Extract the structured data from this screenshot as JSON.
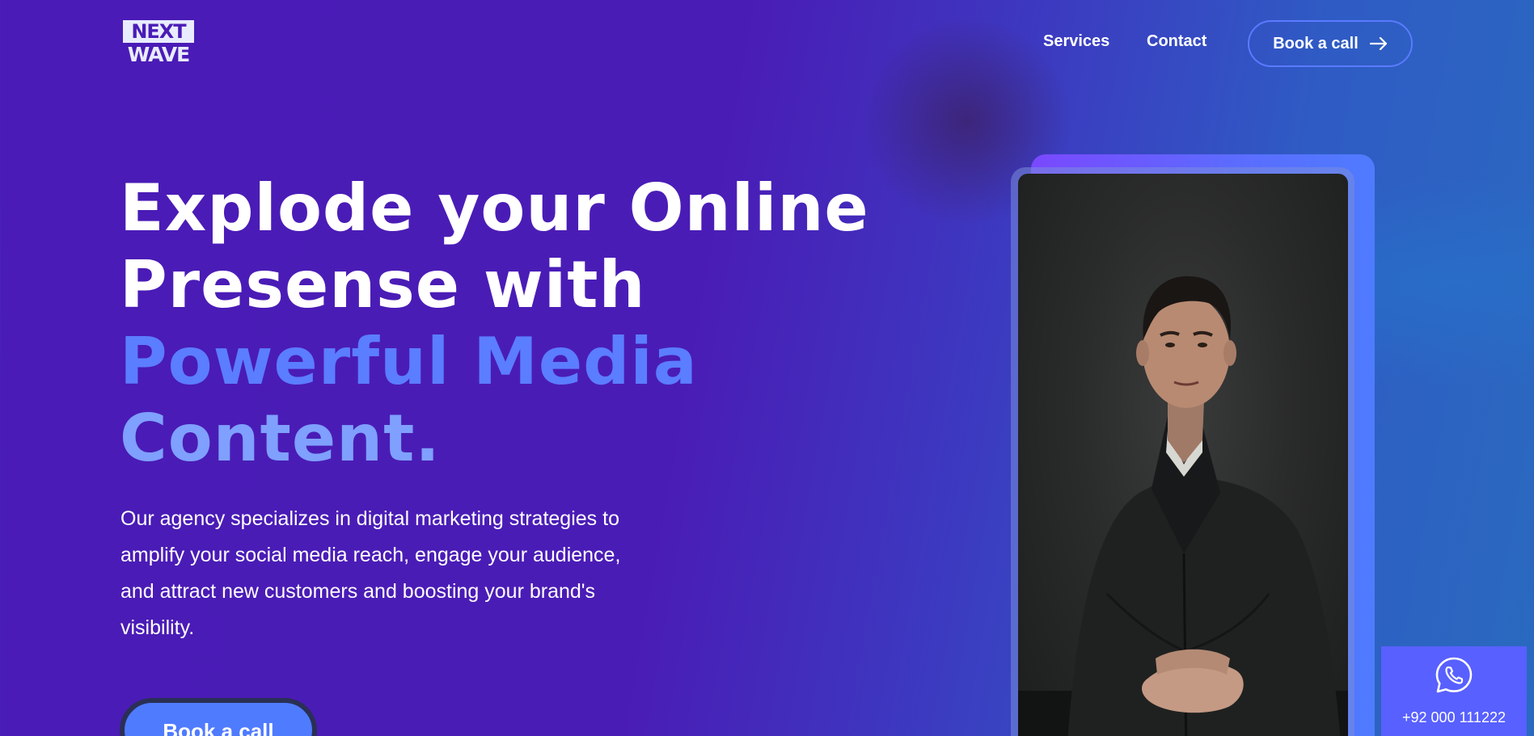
{
  "header": {
    "logo_top": "NEXT",
    "logo_bottom": "WAVE",
    "nav": {
      "services": "Services",
      "contact": "Contact"
    },
    "cta_label": "Book a call",
    "cta_icon": "arrow-right-icon"
  },
  "hero": {
    "title_lines": [
      "Explode your Online",
      "Presense with",
      "Powerful Media",
      "Content."
    ],
    "description": "Our agency specializes in digital marketing strategies to amplify your social media reach, engage your audience, and attract new customers and boosting your brand's visibility.",
    "cta_label": "Book a call"
  },
  "whatsapp": {
    "icon": "whatsapp-icon",
    "phone": "+92 000 111222"
  },
  "colors": {
    "background_start": "#4a1bb6",
    "background_end": "#2a6ac0",
    "accent_blue": "#5b7dff",
    "accent_light_blue": "#7fa0ff",
    "button_blue": "#4f7bff",
    "whatsapp_widget": "#5860ff"
  }
}
